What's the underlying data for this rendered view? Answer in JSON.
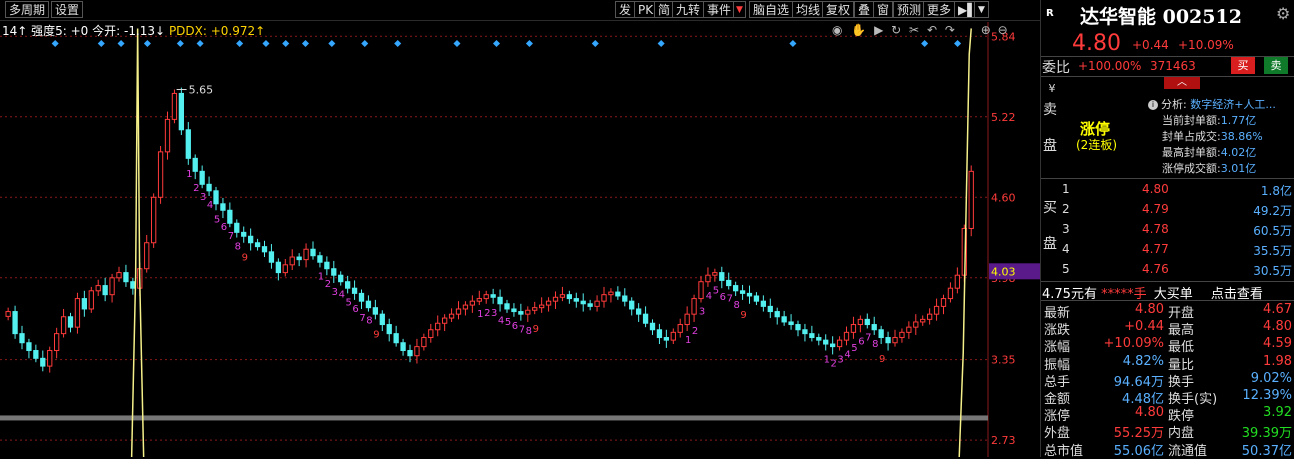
{
  "toolbar": {
    "left": [
      "多周期",
      "设置"
    ],
    "right": [
      "发",
      "PK",
      "简",
      "九转",
      "事件",
      "脑自选",
      "均线",
      "复权",
      "叠",
      "窗",
      "预测",
      "更多"
    ]
  },
  "infobar": {
    "a": "14↑ 强度5: +0 今开: -1.13↓",
    "b": "PDDX: +0.972↑"
  },
  "axis": {
    "ticks": [
      "5.84",
      "5.22",
      "4.60",
      "3.98",
      "3.35",
      "2.73"
    ],
    "current": "4.03",
    "peak_label": "5.65"
  },
  "chart_data": {
    "type": "candlestick",
    "ylim": [
      2.6,
      5.95
    ],
    "closes": [
      3.72,
      3.55,
      3.48,
      3.42,
      3.36,
      3.3,
      3.42,
      3.55,
      3.68,
      3.6,
      3.82,
      3.74,
      3.88,
      3.92,
      3.85,
      3.98,
      4.02,
      3.95,
      3.9,
      4.05,
      4.25,
      4.6,
      4.95,
      5.2,
      5.4,
      5.12,
      4.9,
      4.8,
      4.7,
      4.65,
      4.55,
      4.5,
      4.4,
      4.33,
      4.3,
      4.25,
      4.22,
      4.18,
      4.1,
      4.02,
      4.08,
      4.14,
      4.12,
      4.2,
      4.15,
      4.1,
      4.05,
      4.0,
      3.95,
      3.9,
      3.86,
      3.8,
      3.75,
      3.7,
      3.62,
      3.55,
      3.48,
      3.42,
      3.38,
      3.45,
      3.52,
      3.58,
      3.63,
      3.67,
      3.7,
      3.74,
      3.77,
      3.8,
      3.82,
      3.85,
      3.83,
      3.78,
      3.74,
      3.72,
      3.7,
      3.73,
      3.75,
      3.77,
      3.8,
      3.83,
      3.85,
      3.82,
      3.8,
      3.78,
      3.76,
      3.8,
      3.85,
      3.87,
      3.84,
      3.8,
      3.74,
      3.7,
      3.63,
      3.58,
      3.52,
      3.5,
      3.56,
      3.62,
      3.7,
      3.82,
      3.95,
      4.0,
      4.02,
      3.96,
      3.92,
      3.88,
      3.86,
      3.84,
      3.8,
      3.76,
      3.72,
      3.68,
      3.64,
      3.62,
      3.58,
      3.55,
      3.52,
      3.5,
      3.47,
      3.45,
      3.5,
      3.56,
      3.62,
      3.66,
      3.62,
      3.58,
      3.52,
      3.48,
      3.52,
      3.56,
      3.6,
      3.64,
      3.66,
      3.7,
      3.76,
      3.82,
      3.9,
      4.0,
      4.36,
      4.8
    ],
    "nine_turn_labels": [
      "1",
      "2",
      "3",
      "4",
      "5",
      "6",
      "7",
      "8",
      "9",
      "1",
      "2",
      "3",
      "4",
      "5",
      "6",
      "7",
      "8",
      "9",
      "1",
      "2",
      "3",
      "4",
      "5",
      "6",
      "7",
      "8",
      "9",
      "1",
      "2",
      "3",
      "4",
      "5",
      "6",
      "7",
      "8",
      "9",
      "1",
      "2",
      "3",
      "4",
      "5",
      "6",
      "7",
      "8",
      "9"
    ]
  },
  "quote": {
    "symbol_tag": "R",
    "name": "达华智能 002512",
    "price": "4.80",
    "change": "+0.44",
    "pct": "+10.09%"
  },
  "committee": {
    "label": "委比",
    "value": "+100.00%",
    "volume": "371463",
    "buy": "买",
    "sell": "卖"
  },
  "sell_side": {
    "labels": [
      "¥",
      "卖",
      "盘"
    ],
    "limit": "涨停",
    "limit_sub": "(2连板)",
    "analysis_label": "分析:",
    "analysis_value": "数字经济+人工...",
    "rows": [
      {
        "label": "当前封单额:",
        "value": "1.77亿"
      },
      {
        "label": "封单占成交:",
        "value": "38.86%"
      },
      {
        "label": "最高封单额:",
        "value": "4.02亿"
      },
      {
        "label": "涨停成交额:",
        "value": "3.01亿"
      }
    ]
  },
  "buy_side": {
    "labels": [
      "买",
      "盘"
    ],
    "rows": [
      {
        "idx": "1",
        "price": "4.80",
        "vol": "1.8亿"
      },
      {
        "idx": "2",
        "price": "4.79",
        "vol": "49.2万"
      },
      {
        "idx": "3",
        "price": "4.78",
        "vol": "60.5万"
      },
      {
        "idx": "4",
        "price": "4.77",
        "vol": "35.5万"
      },
      {
        "idx": "5",
        "price": "4.76",
        "vol": "30.5万"
      }
    ]
  },
  "ticker": {
    "a": "4.75元有",
    "stars": "*****手",
    "b": "大买单",
    "c": "点击查看"
  },
  "stats": [
    {
      "l1": "最新",
      "v1": "4.80",
      "c1": "red",
      "l2": "开盘",
      "v2": "4.67",
      "c2": "red"
    },
    {
      "l1": "涨跌",
      "v1": "+0.44",
      "c1": "red",
      "l2": "最高",
      "v2": "4.80",
      "c2": "red"
    },
    {
      "l1": "涨幅",
      "v1": "+10.09%",
      "c1": "red",
      "l2": "最低",
      "v2": "4.59",
      "c2": "red"
    },
    {
      "l1": "振幅",
      "v1": "4.82%",
      "c1": "cyan",
      "l2": "量比",
      "v2": "1.98",
      "c2": "red"
    },
    {
      "l1": "总手",
      "v1": "94.64万",
      "c1": "cyan",
      "l2": "换手",
      "v2": "9.02%",
      "c2": "cyan"
    },
    {
      "l1": "金额",
      "v1": "4.48亿",
      "c1": "cyan",
      "l2": "换手(实)",
      "v2": "12.39%",
      "c2": "cyan"
    },
    {
      "l1": "涨停",
      "v1": "4.80",
      "c1": "red",
      "l2": "跌停",
      "v2": "3.92",
      "c2": "green"
    },
    {
      "l1": "外盘",
      "v1": "55.25万",
      "c1": "red",
      "l2": "内盘",
      "v2": "39.39万",
      "c2": "green"
    },
    {
      "l1": "总市值",
      "v1": "55.06亿",
      "c1": "cyan",
      "l2": "流通值",
      "v2": "50.37亿",
      "c2": "cyan"
    }
  ],
  "colors": {
    "up": "#ff3b3b",
    "down": "#54f0f0",
    "accent": "#ffff00"
  }
}
